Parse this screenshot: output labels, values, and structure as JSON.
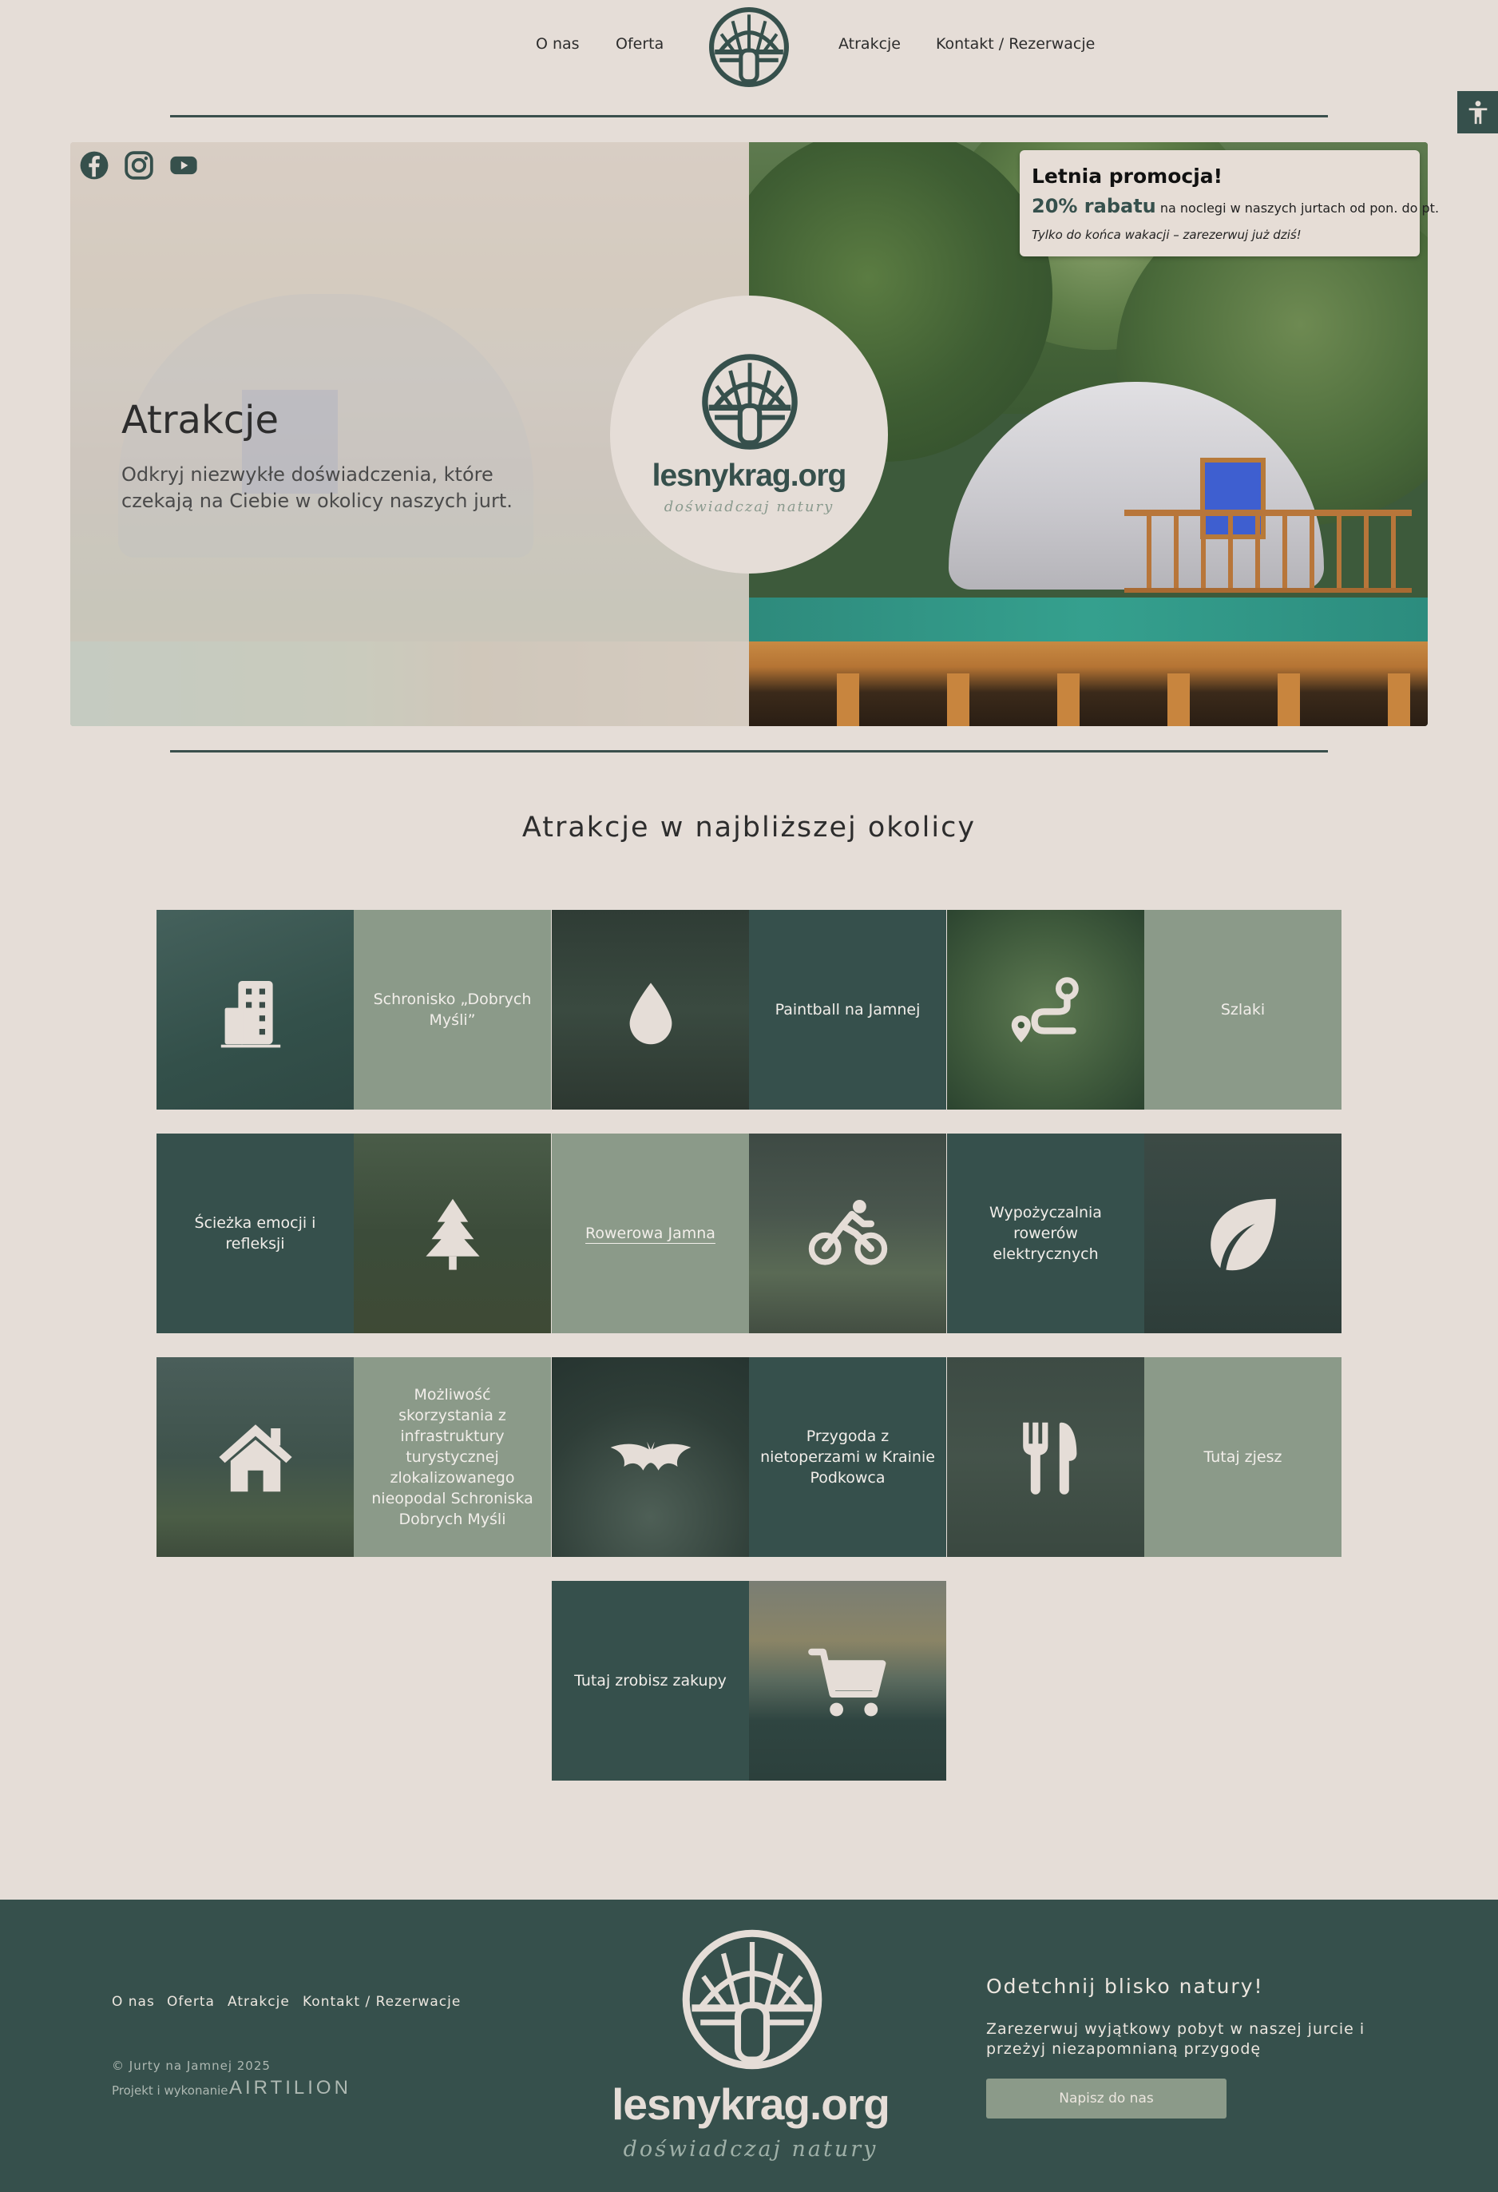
{
  "header": {
    "nav_left": [
      "O nas",
      "Oferta"
    ],
    "nav_right": [
      "Atrakcje",
      "Kontakt / Rezerwacje"
    ]
  },
  "promo": {
    "title": "Letnia promocja!",
    "discount": "20% rabatu",
    "text": "na noclegi w naszych jurtach od pon. do pt.",
    "note": "Tylko do końca wakacji – zarezerwuj już dziś!"
  },
  "hero": {
    "brand": "lesnykrag.org",
    "tagline": "doświadczaj natury",
    "title": "Atrakcje",
    "subtitle": "Odkryj niezwykłe doświadczenia, które czekają na Ciebie w okolicy naszych jurt."
  },
  "social": [
    "facebook-icon",
    "instagram-icon",
    "youtube-icon"
  ],
  "section": {
    "title": "Atrakcje w najbliższej okolicy"
  },
  "attractions": [
    {
      "label": "Schronisko „Dobrych Myśli”",
      "icon": "building-icon"
    },
    {
      "label": "Paintball na Jamnej",
      "icon": "drop-icon"
    },
    {
      "label": "Szlaki",
      "icon": "route-icon"
    },
    {
      "label": "Ścieżka emocji i refleksji",
      "icon": "tree-icon"
    },
    {
      "label": "Rowerowa Jamna",
      "icon": "bicycle-icon"
    },
    {
      "label": "Wypożyczalnia rowerów elektrycznych",
      "icon": "leaf-icon"
    },
    {
      "label": "Możliwość skorzystania z infrastruktury turystycznej zlokalizowanego nieopodal Schroniska Dobrych Myśli",
      "icon": "house-icon"
    },
    {
      "label": "Przygoda z nietoperzami w Krainie Podkowca",
      "icon": "bat-icon"
    },
    {
      "label": "Tutaj zjesz",
      "icon": "cutlery-icon"
    },
    {
      "label": "Tutaj zrobisz zakupy",
      "icon": "cart-icon"
    }
  ],
  "footer": {
    "links": [
      "O nas",
      "Oferta",
      "Atrakcje",
      "Kontakt / Rezerwacje"
    ],
    "copyright": "© Jurty na Jamnej 2025",
    "credit": "Projekt i wykonanie",
    "agency": "AIRTILION",
    "brand": "lesnykrag.org",
    "tagline": "doświadczaj natury",
    "heading": "Odetchnij blisko natury!",
    "text": "Zarezerwuj wyjątkowy pobyt w naszej jurcie i przeżyj niezapomnianą przygodę",
    "button": "Napisz do nas"
  },
  "colors": {
    "background": "#e5ddd7",
    "dark_green": "#36504c",
    "sage": "#8b9a89",
    "text": "#2d2d2d"
  }
}
